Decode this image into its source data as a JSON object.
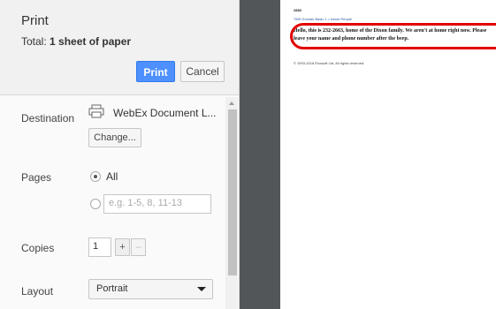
{
  "print_panel": {
    "title": "Print",
    "total_label": "Total:",
    "total_value": "1 sheet of paper",
    "print_button": "Print",
    "cancel_button": "Cancel"
  },
  "destination": {
    "label": "Destination",
    "printer_name": "WebEx Document L...",
    "change_button": "Change...",
    "icon": "printer-icon"
  },
  "pages": {
    "label": "Pages",
    "all_option": "All",
    "all_selected": true,
    "range_placeholder": "e.g. 1-5, 8, 11-13"
  },
  "copies": {
    "label": "Copies",
    "value": "1",
    "increment": "+",
    "decrement": "–"
  },
  "layout": {
    "label": "Layout",
    "selected": "Portrait"
  },
  "preview": {
    "header": "2883",
    "breadcrumb": "TMS Domain Basic 1 > About People",
    "body_text": "Hello, this is 232-2663, home of the Dixon family. We aren't at home right now. Please leave your name and phone number after the beep.",
    "copyright": "© 1993-2016 Elcosoft Ltd. All rights reserved.",
    "highlight_color": "#e20000"
  }
}
